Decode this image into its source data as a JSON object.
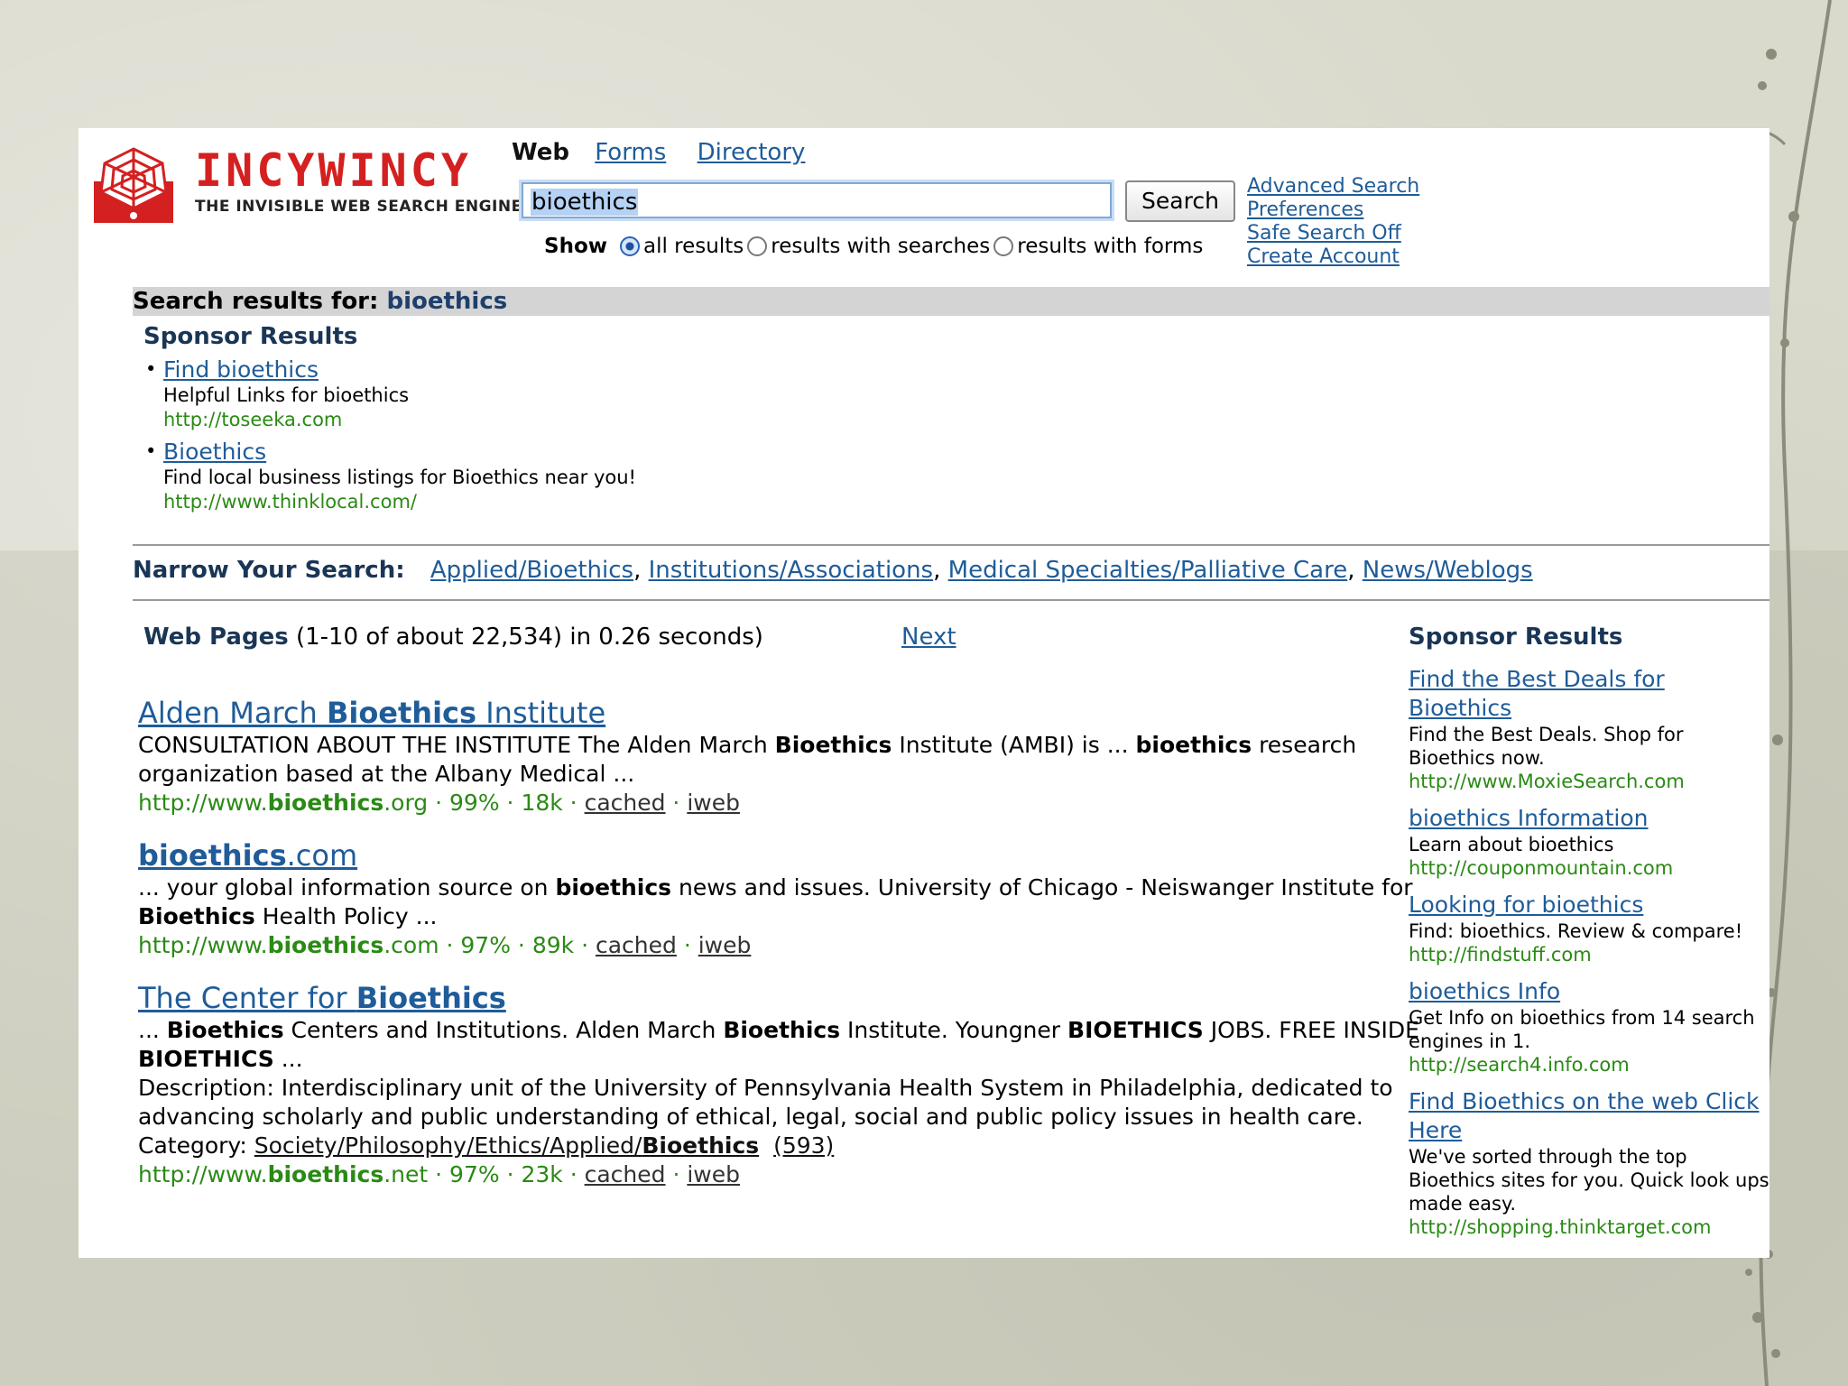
{
  "logo": {
    "name": "INCYWINCY",
    "tagline": "THE INVISIBLE WEB SEARCH ENGINE"
  },
  "tabs": {
    "current": "Web",
    "forms": "Forms",
    "directory": "Directory"
  },
  "search": {
    "value": "bioethics",
    "button": "Search"
  },
  "show": {
    "label": "Show",
    "options": [
      "all results",
      "results with searches",
      "results with forms"
    ],
    "selected": "all results"
  },
  "side_links": [
    "Advanced Search",
    "Preferences",
    "Safe Search Off",
    "Create Account"
  ],
  "results_for": {
    "label": "Search results for:",
    "query": "bioethics"
  },
  "sponsor_top": {
    "heading": "Sponsor Results",
    "items": [
      {
        "title": "Find bioethics",
        "desc": "Helpful Links for bioethics",
        "url": "http://toseeka.com"
      },
      {
        "title": "Bioethics",
        "desc": "Find local business listings for Bioethics near you!",
        "url": "http://www.thinklocal.com/"
      }
    ]
  },
  "narrow": {
    "label": "Narrow Your Search:",
    "links": [
      "Applied/Bioethics",
      "Institutions/Associations",
      "Medical Specialties/Palliative Care",
      "News/Weblogs"
    ]
  },
  "webpages": {
    "label": "Web Pages",
    "summary": "(1-10 of about 22,534) in 0.26 seconds)",
    "next": "Next"
  },
  "results": [
    {
      "title_pre": "Alden March ",
      "title_bold": "Bioethics",
      "title_post": " Institute",
      "snippet": [
        {
          "t": "CONSULTATION ABOUT THE INSTITUTE The Alden March "
        },
        {
          "b": "Bioethics"
        },
        {
          "t": " Institute (AMBI) is ... "
        },
        {
          "b": "bioethics"
        },
        {
          "t": " research organization based at the Albany Medical ..."
        }
      ],
      "url_pre": "http://www.",
      "url_bold": "bioethics",
      "url_post": ".org",
      "pct": "99%",
      "size": "18k",
      "cached": "cached",
      "iweb": "iweb"
    },
    {
      "title_pre": "",
      "title_bold": "bioethics",
      "title_post": ".com ",
      "snippet": [
        {
          "t": "... your global information source on "
        },
        {
          "b": "bioethics"
        },
        {
          "t": " news and issues. University of Chicago - Neiswanger Institute for "
        },
        {
          "b": "Bioethics"
        },
        {
          "t": " Health Policy ..."
        }
      ],
      "url_pre": "http://www.",
      "url_bold": "bioethics",
      "url_post": ".com",
      "pct": "97%",
      "size": "89k",
      "cached": "cached",
      "iweb": "iweb"
    },
    {
      "title_pre": "The Center for ",
      "title_bold": "Bioethics",
      "title_post": "",
      "snippet": [
        {
          "t": "... "
        },
        {
          "b": "Bioethics"
        },
        {
          "t": " Centers and Institutions. Alden March "
        },
        {
          "b": "Bioethics"
        },
        {
          "t": " Institute. Youngner "
        },
        {
          "b": "BIOETHICS"
        },
        {
          "t": " JOBS. FREE INSIDE "
        },
        {
          "b": "BIOETHICS"
        },
        {
          "t": " ..."
        }
      ],
      "description": "Description: Interdisciplinary unit of the University of Pennsylvania Health System in Philadelphia, dedicated to advancing scholarly and public understanding of ethical, legal, social and public policy issues in health care.",
      "category_label": "Category:",
      "category_path": "Society/Philosophy/Ethics/Applied/",
      "category_bold": "Bioethics",
      "category_count": "(593)",
      "url_pre": "http://www.",
      "url_bold": "bioethics",
      "url_post": ".net",
      "pct": "97%",
      "size": "23k",
      "cached": "cached",
      "iweb": "iweb"
    }
  ],
  "sponsor_right": {
    "heading": "Sponsor Results",
    "ads": [
      {
        "title": "Find the Best Deals for Bioethics",
        "desc": "Find the Best Deals. Shop for Bioethics now.",
        "url": "http://www.MoxieSearch.com"
      },
      {
        "title": "bioethics Information",
        "desc": "Learn about bioethics",
        "url": "http://couponmountain.com"
      },
      {
        "title": "Looking for bioethics",
        "desc": "Find: bioethics. Review & compare!",
        "url": "http://findstuff.com"
      },
      {
        "title": "bioethics Info",
        "desc": "Get Info on bioethics from 14 search engines in 1.",
        "url": "http://search4.info.com"
      },
      {
        "title": "Find Bioethics on the web Click Here",
        "desc": "We've sorted through the top Bioethics sites for you. Quick look ups made easy.",
        "url": "http://shopping.thinktarget.com"
      }
    ]
  },
  "colors": {
    "brand_red": "#d42020",
    "link_blue": "#1f5c99",
    "url_green": "#2a8a14",
    "heading_navy": "#1a3656"
  }
}
